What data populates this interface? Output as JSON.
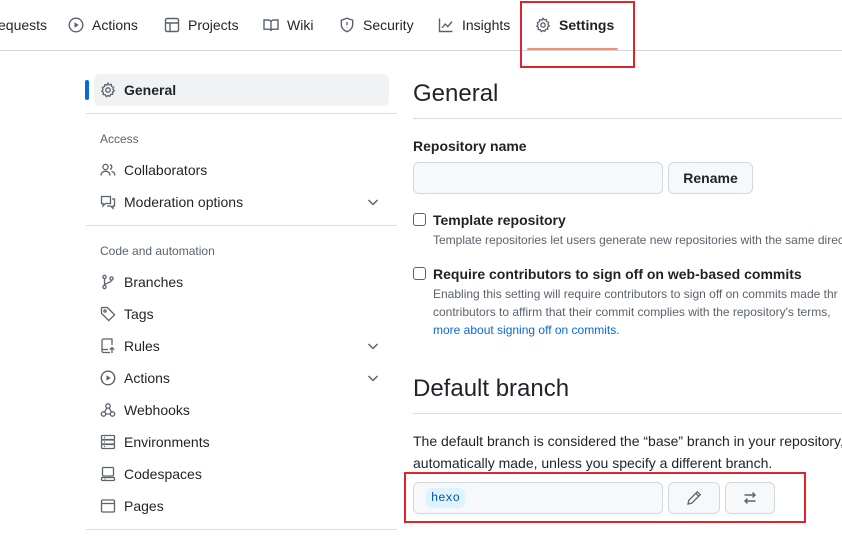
{
  "nav": {
    "tabs": [
      {
        "label": "equests",
        "icon": "pull-request-icon"
      },
      {
        "label": "Actions",
        "icon": "play-icon"
      },
      {
        "label": "Projects",
        "icon": "table-icon"
      },
      {
        "label": "Wiki",
        "icon": "book-icon"
      },
      {
        "label": "Security",
        "icon": "shield-icon"
      },
      {
        "label": "Insights",
        "icon": "graph-icon"
      },
      {
        "label": "Settings",
        "icon": "gear-icon",
        "active": true
      }
    ]
  },
  "sidebar": {
    "general": "General",
    "groups": {
      "access": "Access",
      "code": "Code and automation"
    },
    "items": {
      "collaborators": "Collaborators",
      "moderation": "Moderation options",
      "branches": "Branches",
      "tags": "Tags",
      "rules": "Rules",
      "actions": "Actions",
      "webhooks": "Webhooks",
      "environments": "Environments",
      "codespaces": "Codespaces",
      "pages": "Pages"
    }
  },
  "main": {
    "title": "General",
    "repo_name": {
      "label": "Repository name",
      "value": "",
      "rename_button": "Rename"
    },
    "template": {
      "label": "Template repository",
      "description": "Template repositories let users generate new repositories with the same direct"
    },
    "signoff": {
      "label": "Require contributors to sign off on web-based commits",
      "description_line1": "Enabling this setting will require contributors to sign off on commits made thr",
      "description_line2": "contributors to affirm that their commit complies with the repository's terms,",
      "link_text": "more about signing off on commits."
    },
    "default_branch": {
      "title": "Default branch",
      "description_line1": "The default branch is considered the “base” branch in your repository,",
      "description_line2": "automatically made, unless you specify a different branch.",
      "branch": "hexo"
    }
  },
  "colors": {
    "accent": "#0969da",
    "highlight": "#e0242a",
    "tab_underline": "#fd8c73"
  }
}
